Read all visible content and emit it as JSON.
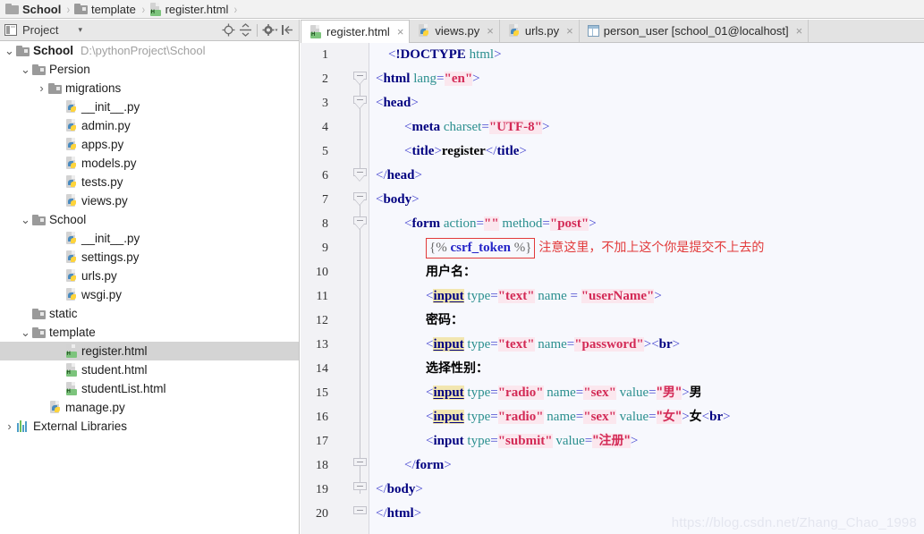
{
  "breadcrumb": {
    "items": [
      {
        "label": "School",
        "icon": "folder-icon",
        "bold": true
      },
      {
        "label": "template",
        "icon": "folder-icon",
        "bold": false
      },
      {
        "label": "register.html",
        "icon": "html-file-icon",
        "bold": false
      }
    ],
    "separator": "›"
  },
  "project_panel": {
    "title": "Project",
    "caret": "▾",
    "toolbar": [
      {
        "name": "locate-in-tree-icon",
        "tooltip": "Select Opened File"
      },
      {
        "name": "collapse-all-icon",
        "tooltip": "Collapse All"
      },
      {
        "name": "gear-icon",
        "tooltip": "Settings"
      },
      {
        "name": "hide-panel-icon",
        "tooltip": "Hide"
      }
    ],
    "tree": [
      {
        "label": "School",
        "path": "D:\\pythonProject\\School",
        "icon": "folder-icon",
        "indent": 0,
        "arrow": "⌄",
        "bold": true,
        "selected": false
      },
      {
        "label": "Persion",
        "path": "",
        "icon": "folder-icon",
        "indent": 1,
        "arrow": "⌄",
        "bold": false,
        "selected": false
      },
      {
        "label": "migrations",
        "path": "",
        "icon": "folder-icon",
        "indent": 2,
        "arrow": "›",
        "bold": false,
        "selected": false
      },
      {
        "label": "__init__.py",
        "path": "",
        "icon": "python-file-icon",
        "indent": 3,
        "arrow": "",
        "bold": false,
        "selected": false
      },
      {
        "label": "admin.py",
        "path": "",
        "icon": "python-file-icon",
        "indent": 3,
        "arrow": "",
        "bold": false,
        "selected": false
      },
      {
        "label": "apps.py",
        "path": "",
        "icon": "python-file-icon",
        "indent": 3,
        "arrow": "",
        "bold": false,
        "selected": false
      },
      {
        "label": "models.py",
        "path": "",
        "icon": "python-file-icon",
        "indent": 3,
        "arrow": "",
        "bold": false,
        "selected": false
      },
      {
        "label": "tests.py",
        "path": "",
        "icon": "python-file-icon",
        "indent": 3,
        "arrow": "",
        "bold": false,
        "selected": false
      },
      {
        "label": "views.py",
        "path": "",
        "icon": "python-file-icon",
        "indent": 3,
        "arrow": "",
        "bold": false,
        "selected": false
      },
      {
        "label": "School",
        "path": "",
        "icon": "folder-icon",
        "indent": 1,
        "arrow": "⌄",
        "bold": false,
        "selected": false
      },
      {
        "label": "__init__.py",
        "path": "",
        "icon": "python-file-icon",
        "indent": 3,
        "arrow": "",
        "bold": false,
        "selected": false
      },
      {
        "label": "settings.py",
        "path": "",
        "icon": "python-file-icon",
        "indent": 3,
        "arrow": "",
        "bold": false,
        "selected": false
      },
      {
        "label": "urls.py",
        "path": "",
        "icon": "python-file-icon",
        "indent": 3,
        "arrow": "",
        "bold": false,
        "selected": false
      },
      {
        "label": "wsgi.py",
        "path": "",
        "icon": "python-file-icon",
        "indent": 3,
        "arrow": "",
        "bold": false,
        "selected": false
      },
      {
        "label": "static",
        "path": "",
        "icon": "folder-icon",
        "indent": 1,
        "arrow": "",
        "bold": false,
        "selected": false
      },
      {
        "label": "template",
        "path": "",
        "icon": "folder-icon",
        "indent": 1,
        "arrow": "⌄",
        "bold": false,
        "selected": false
      },
      {
        "label": "register.html",
        "path": "",
        "icon": "html-file-icon",
        "indent": 3,
        "arrow": "",
        "bold": false,
        "selected": true
      },
      {
        "label": "student.html",
        "path": "",
        "icon": "html-file-icon",
        "indent": 3,
        "arrow": "",
        "bold": false,
        "selected": false
      },
      {
        "label": "studentList.html",
        "path": "",
        "icon": "html-file-icon",
        "indent": 3,
        "arrow": "",
        "bold": false,
        "selected": false
      },
      {
        "label": "manage.py",
        "path": "",
        "icon": "python-file-icon",
        "indent": 2,
        "arrow": "",
        "bold": false,
        "selected": false
      },
      {
        "label": "External Libraries",
        "path": "",
        "icon": "library-icon",
        "indent": 0,
        "arrow": "›",
        "bold": false,
        "selected": false
      }
    ]
  },
  "editor": {
    "tabs": [
      {
        "label": "register.html",
        "icon": "html-file-icon",
        "active": true,
        "close": "×"
      },
      {
        "label": "views.py",
        "icon": "python-file-icon",
        "active": false,
        "close": "×"
      },
      {
        "label": "urls.py",
        "icon": "python-file-icon",
        "active": false,
        "close": "×"
      },
      {
        "label": "person_user [school_01@localhost]",
        "icon": "database-table-icon",
        "active": false,
        "close": "×"
      }
    ],
    "line_numbers": [
      "1",
      "2",
      "3",
      "4",
      "5",
      "6",
      "7",
      "8",
      "9",
      "10",
      "11",
      "12",
      "13",
      "14",
      "15",
      "16",
      "17",
      "18",
      "19",
      "20"
    ],
    "lines": [
      {
        "n": "1",
        "text": "<!DOCTYPE html>"
      },
      {
        "n": "2",
        "text": "<html lang=\"en\">"
      },
      {
        "n": "3",
        "text": "<head>"
      },
      {
        "n": "4",
        "text": "    <meta charset=\"UTF-8\">"
      },
      {
        "n": "5",
        "text": "    <title>register</title>"
      },
      {
        "n": "6",
        "text": "</head>"
      },
      {
        "n": "7",
        "text": "<body>"
      },
      {
        "n": "8",
        "text": "    <form action=\"\" method=\"post\">"
      },
      {
        "n": "9",
        "text": "        {% csrf_token %}"
      },
      {
        "n": "10",
        "text": "        用户名："
      },
      {
        "n": "11",
        "text": "        <input type=\"text\" name = \"userName\">"
      },
      {
        "n": "12",
        "text": "        密码："
      },
      {
        "n": "13",
        "text": "        <input type=\"text\" name=\"password\"><br>"
      },
      {
        "n": "14",
        "text": "        选择性别："
      },
      {
        "n": "15",
        "text": "        <input type=\"radio\" name=\"sex\" value=\"男\">男"
      },
      {
        "n": "16",
        "text": "        <input type=\"radio\" name=\"sex\" value=\"女\">女<br>"
      },
      {
        "n": "17",
        "text": "        <input type=\"submit\" value=\"注册\">"
      },
      {
        "n": "18",
        "text": "    </form>"
      },
      {
        "n": "19",
        "text": "</body>"
      },
      {
        "n": "20",
        "text": "</html>"
      }
    ],
    "tokens": {
      "doctype": "!DOCTYPE",
      "html": "html",
      "head": "head",
      "body": "body",
      "meta": "meta",
      "title": "title",
      "form": "form",
      "input": "input",
      "br": "br",
      "lang_attr": "lang",
      "charset_attr": "charset",
      "action_attr": "action",
      "method_attr": "method",
      "type_attr": "type",
      "name_attr": "name",
      "value_attr": "value",
      "lang_val": "\"en\"",
      "charset_val": "\"UTF-8\"",
      "title_text": "register",
      "action_val": "\"\"",
      "method_val": "\"post\"",
      "csrf": "csrf_token",
      "csrf_open": "{%",
      "csrf_close": "%}",
      "label_username": "用户名：",
      "label_password": "密码：",
      "label_sex": "选择性别：",
      "type_text": "\"text\"",
      "type_radio": "\"radio\"",
      "type_submit": "\"submit\"",
      "name_username": "\"userName\"",
      "name_password": "\"password\"",
      "name_sex": "\"sex\"",
      "value_male": "\"男\"",
      "value_female": "\"女\"",
      "value_submit": "\"注册\"",
      "text_male": "男",
      "text_female": "女"
    },
    "annotation": {
      "boxed_text": "{% csrf_token %}",
      "note": "注意这里，不加上这个你是提交不上去的",
      "color": "#e23a3a"
    },
    "watermark": "https://blog.csdn.net/Zhang_Chao_1998"
  },
  "colors": {
    "tag": "#000080",
    "bracket": "#4646d0",
    "attribute": "#2b8f8f",
    "string": "#d32a56",
    "string_bg": "#fbe7ee",
    "identifier_highlight": "#f2e6b0",
    "django_tag": "#2424c8",
    "editor_bg": "#f7f8fd",
    "gutter_bg": "#f2f2f5",
    "toolbar_bg": "#e3e3e3",
    "selection_bg": "#d4d4d4"
  }
}
